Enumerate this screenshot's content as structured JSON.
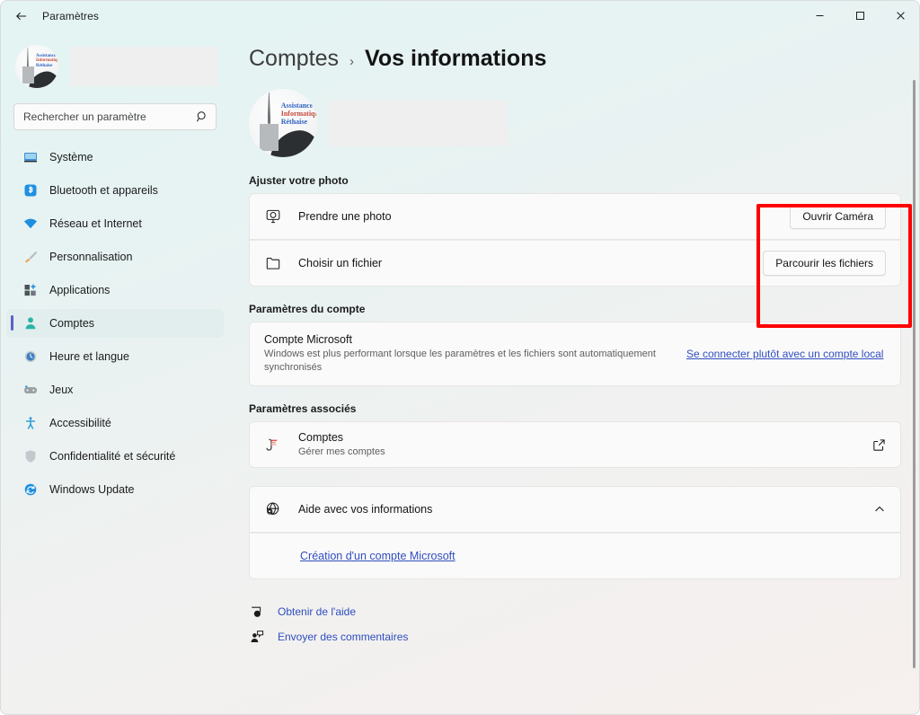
{
  "window": {
    "title": "Paramètres",
    "back_icon": "back-arrow-icon",
    "minimize_label": "–",
    "maximize_label": "□",
    "close_label": "✕"
  },
  "sidebar": {
    "profile": {
      "avatar_alt": "Assistance Informatique Réthaise",
      "name_redacted": ""
    },
    "search": {
      "placeholder": "Rechercher un paramètre",
      "icon": "search-icon"
    },
    "items": [
      {
        "label": "Système",
        "icon": "monitor-icon",
        "selected": false
      },
      {
        "label": "Bluetooth et appareils",
        "icon": "bluetooth-icon",
        "selected": false
      },
      {
        "label": "Réseau et Internet",
        "icon": "wifi-icon",
        "selected": false
      },
      {
        "label": "Personnalisation",
        "icon": "brush-icon",
        "selected": false
      },
      {
        "label": "Applications",
        "icon": "apps-icon",
        "selected": false
      },
      {
        "label": "Comptes",
        "icon": "person-icon",
        "selected": true
      },
      {
        "label": "Heure et langue",
        "icon": "clock-icon",
        "selected": false
      },
      {
        "label": "Jeux",
        "icon": "gamepad-icon",
        "selected": false
      },
      {
        "label": "Accessibilité",
        "icon": "accessibility-icon",
        "selected": false
      },
      {
        "label": "Confidentialité et sécurité",
        "icon": "shield-icon",
        "selected": false
      },
      {
        "label": "Windows Update",
        "icon": "update-icon",
        "selected": false
      }
    ]
  },
  "breadcrumb": {
    "parent": "Comptes",
    "separator": "›",
    "current": "Vos informations"
  },
  "profile_header": {
    "avatar_alt": "Assistance Informatique Réthaise",
    "name_redacted": ""
  },
  "avatar_art": {
    "line1": "Assistance",
    "line2": "Informatique",
    "line3": "Réthaise"
  },
  "sections": {
    "adjust_photo": {
      "title": "Ajuster votre photo",
      "rows": [
        {
          "label": "Prendre une photo",
          "icon": "webcam-icon",
          "button": "Ouvrir Caméra"
        },
        {
          "label": "Choisir un fichier",
          "icon": "folder-icon",
          "button": "Parcourir les fichiers"
        }
      ]
    },
    "account_settings": {
      "title": "Paramètres du compte",
      "row": {
        "label": "Compte Microsoft",
        "sublabel": "Windows est plus performant lorsque les paramètres et les fichiers sont automatiquement synchronisés",
        "link": "Se connecter plutôt avec un compte local"
      }
    },
    "related_settings": {
      "title": "Paramètres associés",
      "row": {
        "label": "Comptes",
        "sublabel": "Gérer mes comptes",
        "icon": "accounts-app-icon",
        "external_icon": "external-link-icon"
      }
    },
    "help": {
      "header": "Aide avec vos informations",
      "header_icon": "globe-help-icon",
      "chevron": "chevron-up-icon",
      "links": [
        "Création d'un compte Microsoft"
      ]
    }
  },
  "footer": {
    "links": [
      {
        "label": "Obtenir de l'aide",
        "icon": "get-help-icon"
      },
      {
        "label": "Envoyer des commentaires",
        "icon": "feedback-icon"
      }
    ]
  },
  "colors": {
    "accent_link": "#2f4ebf",
    "selected_indicator": "#5b5fc7",
    "annotation": "#fe0000",
    "background": "#e3f4f2"
  }
}
